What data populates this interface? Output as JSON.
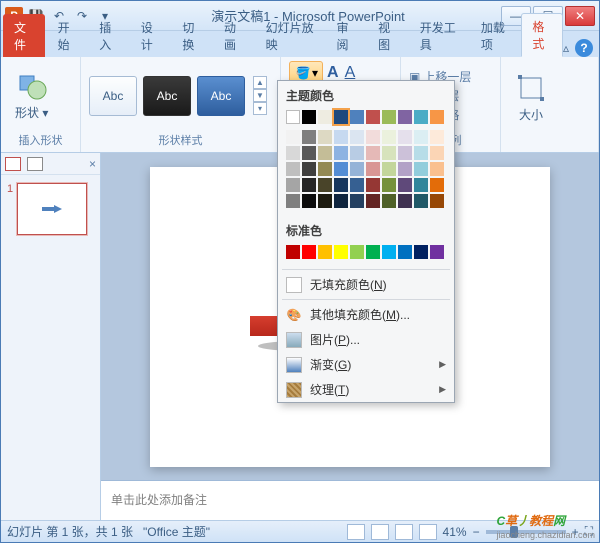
{
  "window": {
    "app_icon": "P",
    "title": "演示文稿1 - Microsoft PowerPoint"
  },
  "tabs": {
    "file": "文件",
    "items": [
      "开始",
      "插入",
      "设计",
      "切换",
      "动画",
      "幻灯片放映",
      "审阅",
      "视图",
      "开发工具",
      "加载项"
    ],
    "contextual": "格式"
  },
  "ribbon": {
    "group_insert": "插入形状",
    "shapes_btn": "形状",
    "group_styles": "形状样式",
    "style_text": "Abc",
    "group_arrange": "排列",
    "arrange_up": "上移一层",
    "arrange_down": "移一层",
    "arrange_pane": "择窗格",
    "group_size": "大小"
  },
  "dropdown": {
    "theme_colors": "主题颜色",
    "standard_colors": "标准色",
    "theme_row1": [
      "#ffffff",
      "#000000",
      "#eeece1",
      "#1f497d",
      "#4f81bd",
      "#c0504d",
      "#9bbb59",
      "#8064a2",
      "#4bacc6",
      "#f79646"
    ],
    "theme_tints": [
      [
        "#f2f2f2",
        "#7f7f7f",
        "#ddd9c3",
        "#c6d9f0",
        "#dbe5f1",
        "#f2dcdb",
        "#ebf1dd",
        "#e5e0ec",
        "#dbeef3",
        "#fdeada"
      ],
      [
        "#d8d8d8",
        "#595959",
        "#c4bd97",
        "#8db3e2",
        "#b8cce4",
        "#e5b9b7",
        "#d7e3bc",
        "#ccc1d9",
        "#b7dde8",
        "#fbd5b5"
      ],
      [
        "#bfbfbf",
        "#3f3f3f",
        "#938953",
        "#548dd4",
        "#95b3d7",
        "#d99694",
        "#c3d69b",
        "#b2a2c7",
        "#92cddc",
        "#fac08f"
      ],
      [
        "#a5a5a5",
        "#262626",
        "#494429",
        "#17365d",
        "#366092",
        "#953734",
        "#76923c",
        "#5f497a",
        "#31859b",
        "#e36c09"
      ],
      [
        "#7f7f7f",
        "#0c0c0c",
        "#1d1b10",
        "#0f243e",
        "#244061",
        "#632423",
        "#4f6128",
        "#3f3151",
        "#205867",
        "#974806"
      ]
    ],
    "standard_row": [
      "#c00000",
      "#ff0000",
      "#ffc000",
      "#ffff00",
      "#92d050",
      "#00b050",
      "#00b0f0",
      "#0070c0",
      "#002060",
      "#7030a0"
    ],
    "no_fill": "无填充颜色(N)",
    "more_fill": "其他填充颜色(M)...",
    "picture": "图片(P)...",
    "gradient": "渐变(G)",
    "texture": "纹理(T)"
  },
  "thumbnails": {
    "slide1_num": "1"
  },
  "notes": {
    "placeholder": "单击此处添加备注"
  },
  "status": {
    "slide_info": "幻灯片 第 1 张，共 1 张",
    "theme": "\"Office 主题\"",
    "lang": "",
    "zoom": "41%"
  }
}
